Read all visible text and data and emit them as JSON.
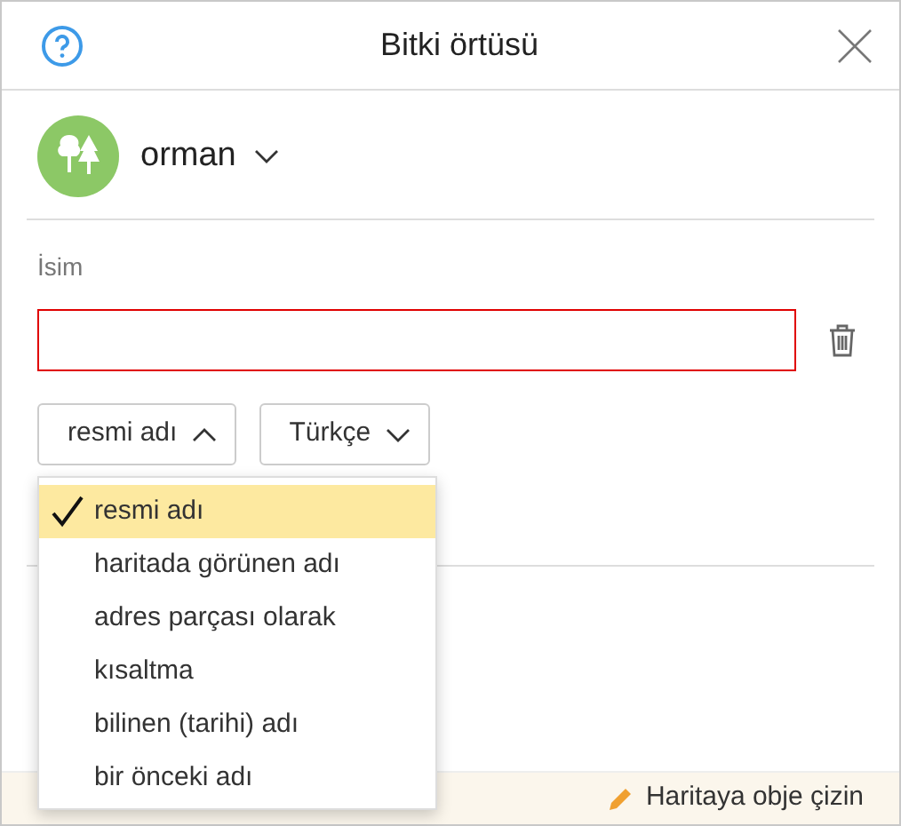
{
  "dialog": {
    "title": "Bitki örtüsü"
  },
  "category": {
    "name": "orman"
  },
  "name_field": {
    "label": "İsim",
    "invalid": true
  },
  "name_type_select": {
    "value": "resmi adı",
    "expanded": true
  },
  "language_select": {
    "value": "Türkçe",
    "expanded": false
  },
  "name_type_options": [
    {
      "label": "resmi adı",
      "selected": true
    },
    {
      "label": "haritada görünen adı",
      "selected": false
    },
    {
      "label": "adres parçası olarak",
      "selected": false
    },
    {
      "label": "kısaltma",
      "selected": false
    },
    {
      "label": "bilinen (tarihi) adı",
      "selected": false
    },
    {
      "label": "bir önceki adı",
      "selected": false
    }
  ],
  "footer": {
    "text": "Haritaya obje çizin"
  }
}
